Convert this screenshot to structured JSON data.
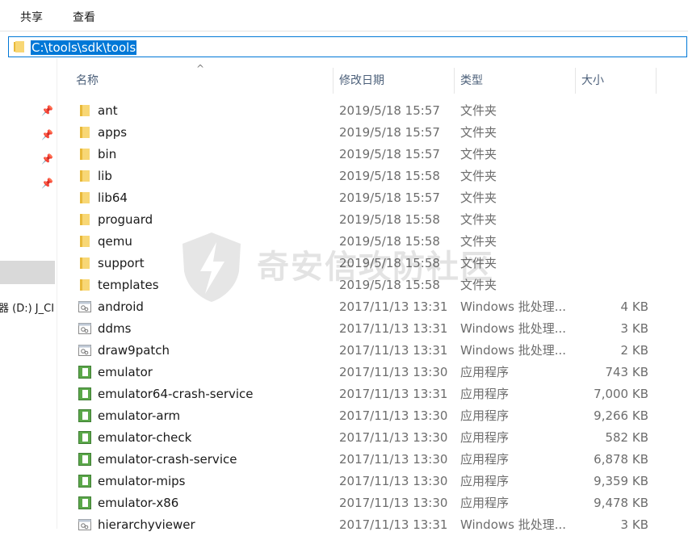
{
  "ribbon": {
    "tabs": [
      "共享",
      "查看"
    ]
  },
  "address": {
    "path": "C:\\tools\\sdk\\tools"
  },
  "nav": {
    "drive_label": "器 (D:) J_CI"
  },
  "columns": {
    "name": "名称",
    "date": "修改日期",
    "type": "类型",
    "size": "大小"
  },
  "files": [
    {
      "name": "ant",
      "date": "2019/5/18 15:57",
      "type": "文件夹",
      "size": "",
      "icon": "folder-icon"
    },
    {
      "name": "apps",
      "date": "2019/5/18 15:57",
      "type": "文件夹",
      "size": "",
      "icon": "folder-icon"
    },
    {
      "name": "bin",
      "date": "2019/5/18 15:57",
      "type": "文件夹",
      "size": "",
      "icon": "folder-icon"
    },
    {
      "name": "lib",
      "date": "2019/5/18 15:58",
      "type": "文件夹",
      "size": "",
      "icon": "folder-icon"
    },
    {
      "name": "lib64",
      "date": "2019/5/18 15:57",
      "type": "文件夹",
      "size": "",
      "icon": "folder-icon"
    },
    {
      "name": "proguard",
      "date": "2019/5/18 15:58",
      "type": "文件夹",
      "size": "",
      "icon": "folder-icon"
    },
    {
      "name": "qemu",
      "date": "2019/5/18 15:58",
      "type": "文件夹",
      "size": "",
      "icon": "folder-icon"
    },
    {
      "name": "support",
      "date": "2019/5/18 15:58",
      "type": "文件夹",
      "size": "",
      "icon": "folder-icon"
    },
    {
      "name": "templates",
      "date": "2019/5/18 15:58",
      "type": "文件夹",
      "size": "",
      "icon": "folder-icon"
    },
    {
      "name": "android",
      "date": "2017/11/13 13:31",
      "type": "Windows 批处理...",
      "size": "4 KB",
      "icon": "batch-file-icon"
    },
    {
      "name": "ddms",
      "date": "2017/11/13 13:31",
      "type": "Windows 批处理...",
      "size": "3 KB",
      "icon": "batch-file-icon"
    },
    {
      "name": "draw9patch",
      "date": "2017/11/13 13:31",
      "type": "Windows 批处理...",
      "size": "2 KB",
      "icon": "batch-file-icon"
    },
    {
      "name": "emulator",
      "date": "2017/11/13 13:30",
      "type": "应用程序",
      "size": "743 KB",
      "icon": "application-icon"
    },
    {
      "name": "emulator64-crash-service",
      "date": "2017/11/13 13:31",
      "type": "应用程序",
      "size": "7,000 KB",
      "icon": "application-icon"
    },
    {
      "name": "emulator-arm",
      "date": "2017/11/13 13:30",
      "type": "应用程序",
      "size": "9,266 KB",
      "icon": "application-icon"
    },
    {
      "name": "emulator-check",
      "date": "2017/11/13 13:30",
      "type": "应用程序",
      "size": "582 KB",
      "icon": "application-icon"
    },
    {
      "name": "emulator-crash-service",
      "date": "2017/11/13 13:30",
      "type": "应用程序",
      "size": "6,878 KB",
      "icon": "application-icon"
    },
    {
      "name": "emulator-mips",
      "date": "2017/11/13 13:30",
      "type": "应用程序",
      "size": "9,359 KB",
      "icon": "application-icon"
    },
    {
      "name": "emulator-x86",
      "date": "2017/11/13 13:30",
      "type": "应用程序",
      "size": "9,478 KB",
      "icon": "application-icon"
    },
    {
      "name": "hierarchyviewer",
      "date": "2017/11/13 13:31",
      "type": "Windows 批处理...",
      "size": "3 KB",
      "icon": "batch-file-icon"
    }
  ],
  "watermark": {
    "text": "奇安信攻防社区"
  },
  "colors": {
    "accent": "#0078d7",
    "folder": "#f8d775",
    "app_icon": "#5ba84a"
  }
}
